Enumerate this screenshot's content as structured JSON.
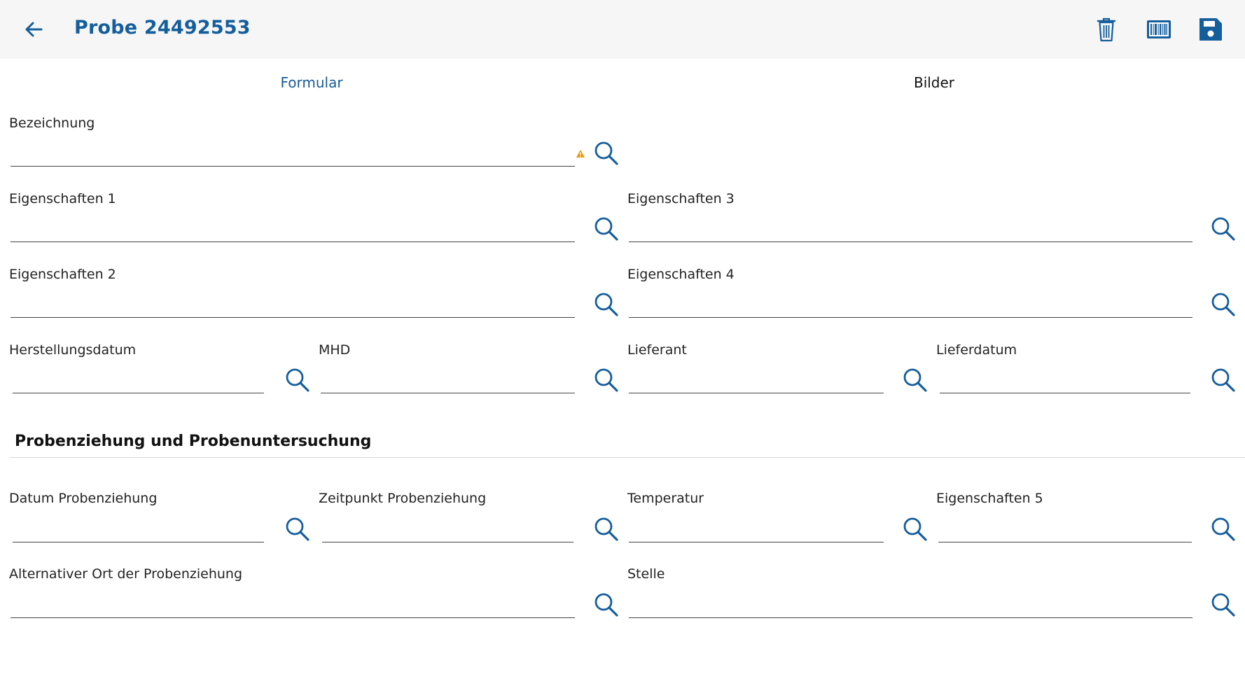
{
  "header": {
    "title": "Probe 24492553",
    "back_icon": "arrow-left-icon",
    "actions": [
      "trash-icon",
      "barcode-icon",
      "save-icon"
    ],
    "accent_color": "#155e9c"
  },
  "tabs": [
    {
      "label": "Formular",
      "active": true
    },
    {
      "label": "Bilder",
      "active": false
    }
  ],
  "fields": {
    "bezeichnung": {
      "label": "Bezeichnung",
      "value": "",
      "warning": true
    },
    "eigenschaften1": {
      "label": "Eigenschaften 1",
      "value": ""
    },
    "eigenschaften3": {
      "label": "Eigenschaften 3",
      "value": ""
    },
    "eigenschaften2": {
      "label": "Eigenschaften 2",
      "value": ""
    },
    "eigenschaften4": {
      "label": "Eigenschaften 4",
      "value": ""
    },
    "herstellungsdatum": {
      "label": "Herstellungsdatum",
      "value": ""
    },
    "mhd": {
      "label": "MHD",
      "value": ""
    },
    "lieferant": {
      "label": "Lieferant",
      "value": ""
    },
    "lieferdatum": {
      "label": "Lieferdatum",
      "value": ""
    }
  },
  "section": {
    "title": "Probenziehung und Probenuntersuchung",
    "fields": {
      "datum": {
        "label": "Datum Probenziehung",
        "value": ""
      },
      "zeitpunkt": {
        "label": "Zeitpunkt Probenziehung",
        "value": ""
      },
      "temperatur": {
        "label": "Temperatur",
        "value": ""
      },
      "eigenschaften5": {
        "label": "Eigenschaften 5",
        "value": ""
      },
      "alternativer_ort": {
        "label": "Alternativer Ort der Probenziehung",
        "value": ""
      },
      "stelle": {
        "label": "Stelle",
        "value": ""
      }
    }
  }
}
